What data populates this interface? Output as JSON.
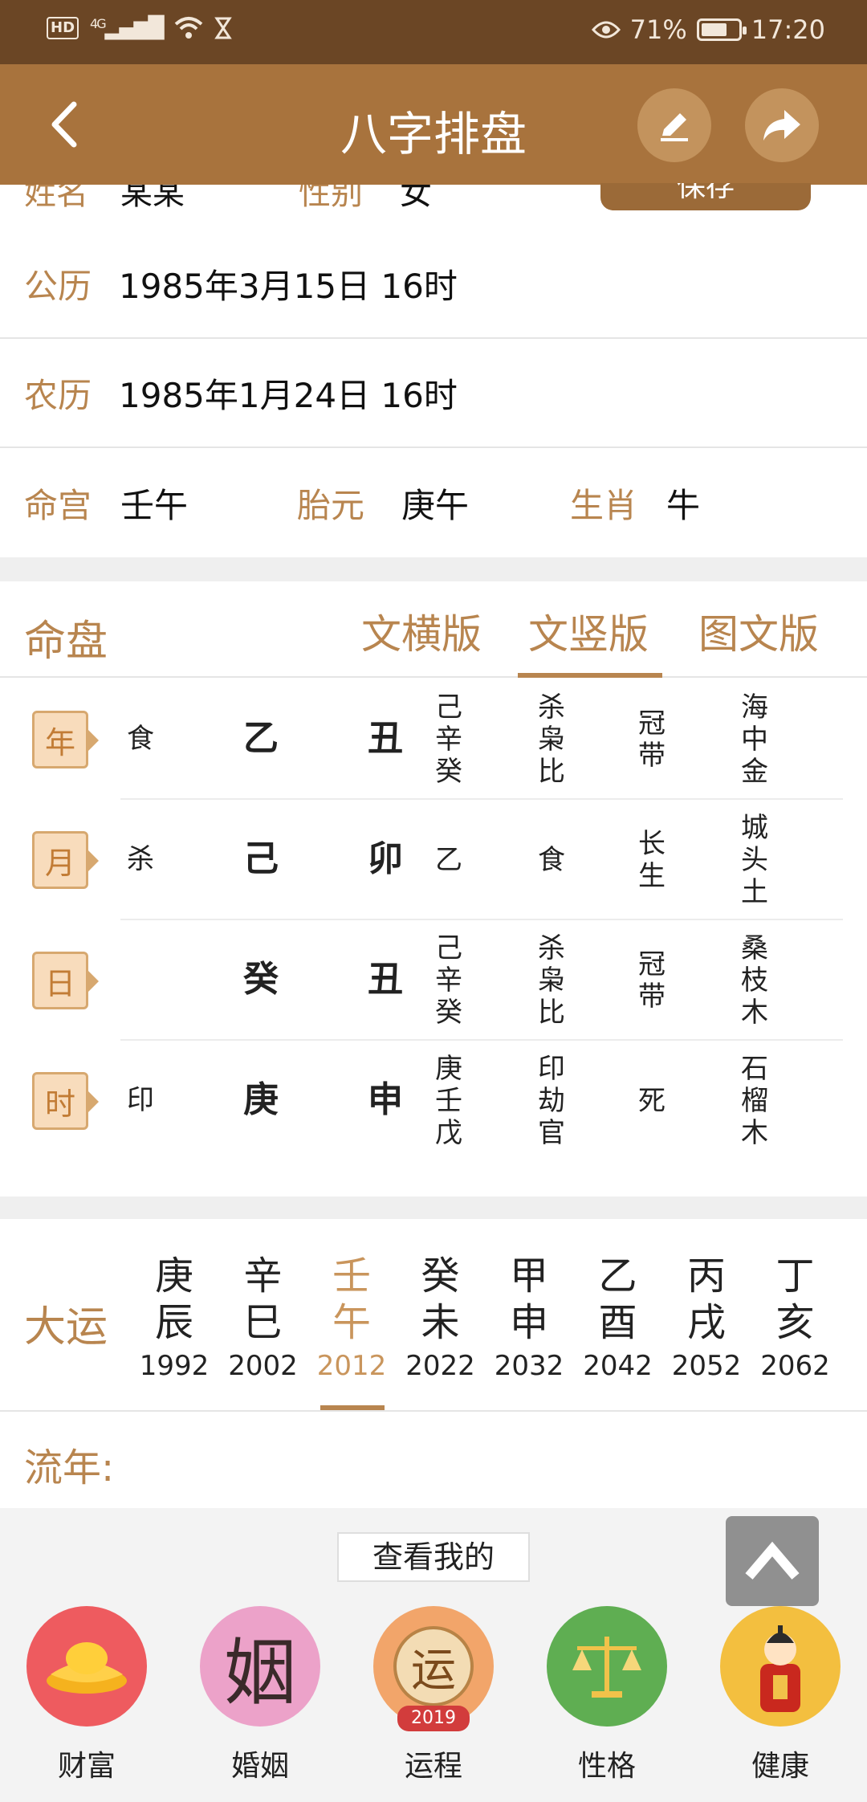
{
  "status": {
    "network": "4G",
    "battery": "71%",
    "battery_level": 0.71,
    "time": "17:20"
  },
  "appbar": {
    "title": "八字排盘"
  },
  "cut_row": {
    "name_label": "姓名",
    "name_value": "某某",
    "gender_label": "性别",
    "gender_value": "女",
    "save_label": "保存"
  },
  "info": {
    "solar_label": "公历",
    "solar_value": "1985年3月15日 16时",
    "lunar_label": "农历",
    "lunar_value": "1985年1月24日 16时",
    "minggong_label": "命宫",
    "minggong_value": "壬午",
    "taiyuan_label": "胎元",
    "taiyuan_value": "庚午",
    "shengxiao_label": "生肖",
    "shengxiao_value": "牛"
  },
  "mingpan": {
    "label": "命盘",
    "tabs": [
      "文横版",
      "文竖版",
      "图文版"
    ],
    "active_tab": 1,
    "pillars": [
      {
        "tag": "年",
        "shishen": "食",
        "gan": "乙",
        "zhi": "丑",
        "canggan": [
          "己",
          "辛",
          "癸"
        ],
        "zhuxing": [
          "杀",
          "枭",
          "比"
        ],
        "changsheng": [
          "冠",
          "带"
        ],
        "nayin": [
          "海",
          "中",
          "金"
        ]
      },
      {
        "tag": "月",
        "shishen": "杀",
        "gan": "己",
        "zhi": "卯",
        "canggan": [
          "乙"
        ],
        "zhuxing": [
          "食"
        ],
        "changsheng": [
          "长",
          "生"
        ],
        "nayin": [
          "城",
          "头",
          "土"
        ]
      },
      {
        "tag": "日",
        "shishen": "",
        "gan": "癸",
        "zhi": "丑",
        "canggan": [
          "己",
          "辛",
          "癸"
        ],
        "zhuxing": [
          "杀",
          "枭",
          "比"
        ],
        "changsheng": [
          "冠",
          "带"
        ],
        "nayin": [
          "桑",
          "枝",
          "木"
        ]
      },
      {
        "tag": "时",
        "shishen": "印",
        "gan": "庚",
        "zhi": "申",
        "canggan": [
          "庚",
          "壬",
          "戊"
        ],
        "zhuxing": [
          "印",
          "劫",
          "官"
        ],
        "changsheng": [
          "死"
        ],
        "nayin": [
          "石",
          "榴",
          "木"
        ]
      }
    ]
  },
  "dayun": {
    "label": "大运",
    "active": 2,
    "items": [
      {
        "gan": "庚",
        "zhi": "辰",
        "year": "1992"
      },
      {
        "gan": "辛",
        "zhi": "巳",
        "year": "2002"
      },
      {
        "gan": "壬",
        "zhi": "午",
        "year": "2012"
      },
      {
        "gan": "癸",
        "zhi": "未",
        "year": "2022"
      },
      {
        "gan": "甲",
        "zhi": "申",
        "year": "2032"
      },
      {
        "gan": "乙",
        "zhi": "酉",
        "year": "2042"
      },
      {
        "gan": "丙",
        "zhi": "戌",
        "year": "2052"
      },
      {
        "gan": "丁",
        "zhi": "亥",
        "year": "2062"
      }
    ]
  },
  "liunian": {
    "label": "流年:"
  },
  "bottom": {
    "see_mine": "查看我的",
    "features": [
      {
        "name": "财富",
        "icon": "gold-ingot-icon",
        "color": "#ee5b5f"
      },
      {
        "name": "婚姻",
        "icon": "marriage-icon",
        "glyph": "姻",
        "color": "#eca2c9"
      },
      {
        "name": "运程",
        "icon": "fortune-icon",
        "glyph": "运",
        "badge": "2019",
        "color": "#f2a56a"
      },
      {
        "name": "性格",
        "icon": "scales-icon",
        "color": "#5fae52"
      },
      {
        "name": "健康",
        "icon": "person-icon",
        "color": "#f3bf3f"
      }
    ]
  }
}
